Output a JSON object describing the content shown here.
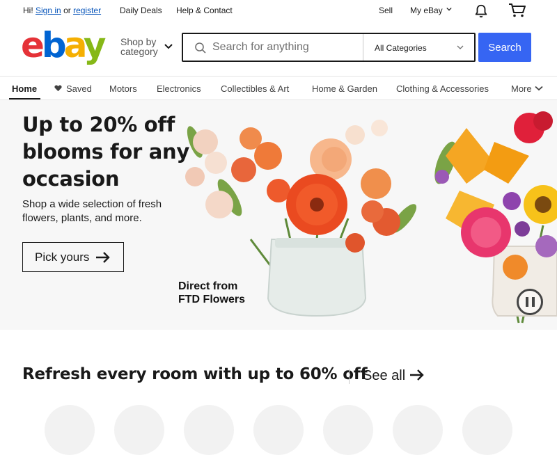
{
  "topbar": {
    "greeting": "Hi!",
    "sign_in": "Sign in",
    "or": "or",
    "register": "register",
    "daily_deals": "Daily Deals",
    "help_contact": "Help & Contact",
    "sell": "Sell",
    "my_ebay": "My eBay"
  },
  "header": {
    "logo": [
      "e",
      "b",
      "a",
      "y"
    ],
    "shop_by_category": "Shop by category",
    "search_placeholder": "Search for anything",
    "category_selected": "All Categories",
    "search_button": "Search"
  },
  "nav": {
    "items": [
      "Home",
      "Saved",
      "Motors",
      "Electronics",
      "Collectibles & Art",
      "Home & Garden",
      "Clothing & Accessories",
      "More"
    ]
  },
  "hero": {
    "title": "Up to 20% off blooms for any occasion",
    "subtitle": "Shop a wide selection of fresh flowers, plants, and more.",
    "cta": "Pick yours",
    "brand": "Direct from\nFTD Flowers"
  },
  "section": {
    "title": "Refresh every room with up to 60% off",
    "see_all": "See all"
  },
  "colors": {
    "accent": "#3665f3",
    "link": "#0654ba",
    "logo_red": "#e53238",
    "logo_blue": "#0064d2",
    "logo_yellow": "#f5af02",
    "logo_green": "#86b817"
  },
  "icons": [
    "bell-icon",
    "cart-icon",
    "search-icon",
    "chevron-down-icon",
    "heart-icon",
    "arrow-right-icon",
    "pause-icon"
  ]
}
